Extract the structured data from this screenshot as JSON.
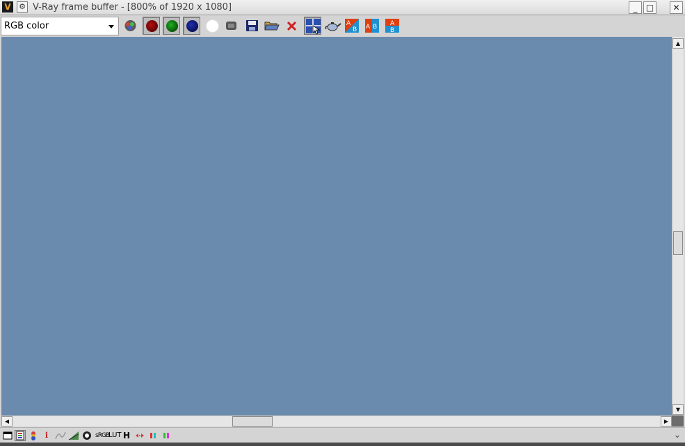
{
  "window": {
    "title": "V-Ray frame buffer - [800% of 1920 x 1080]",
    "app_icon_glyph": "V",
    "menu_icon_glyph": "⚙",
    "minimize_glyph": "_",
    "maximize_glyph": "□",
    "close_glyph": "✕"
  },
  "toolbar": {
    "channel_select_value": "RGB color",
    "buttons": [
      {
        "name": "rgb-channels-icon",
        "pressed": false
      },
      {
        "name": "red-channel-icon",
        "pressed": true
      },
      {
        "name": "green-channel-icon",
        "pressed": true
      },
      {
        "name": "blue-channel-icon",
        "pressed": true
      },
      {
        "name": "alpha-channel-icon",
        "pressed": false
      },
      {
        "name": "monochrome-icon",
        "pressed": false
      },
      {
        "name": "save-image-icon",
        "pressed": false
      },
      {
        "name": "load-image-icon",
        "pressed": false
      },
      {
        "name": "clear-image-icon",
        "pressed": false
      },
      {
        "name": "track-mouse-icon",
        "pressed": true
      },
      {
        "name": "render-teapot-icon",
        "pressed": false
      },
      {
        "name": "compare-ab-horizontal-icon",
        "pressed": false
      },
      {
        "name": "compare-ab-icon",
        "pressed": false
      },
      {
        "name": "compare-ab-vertical-icon",
        "pressed": false
      }
    ],
    "ab_label_a": "A",
    "ab_label_b": "B"
  },
  "viewport": {
    "image_color": "#6a8bad"
  },
  "bottom_toolbar": {
    "info_label": "i",
    "lut_label": "LUT",
    "hist_label": "H",
    "srgb_label": "sRGB"
  },
  "scroll": {
    "up_glyph": "▲",
    "down_glyph": "▼",
    "left_glyph": "◀",
    "right_glyph": "▶",
    "expand_glyph": "⌄"
  }
}
